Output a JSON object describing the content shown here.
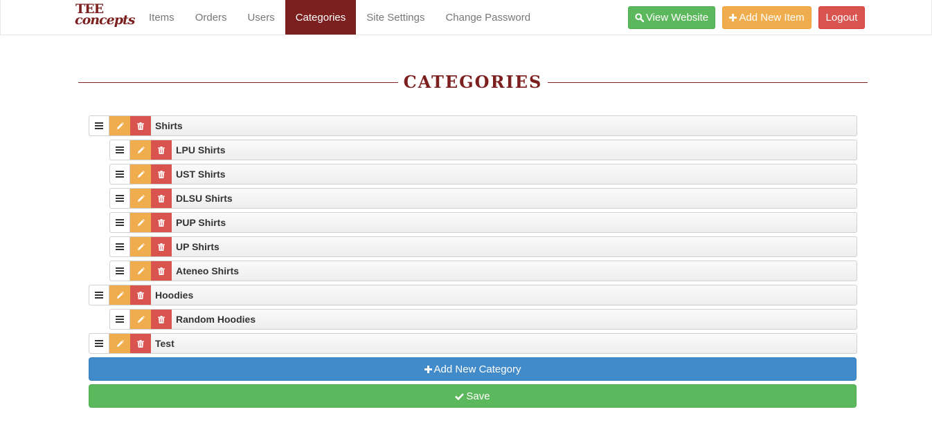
{
  "brand": {
    "line1": "TEE",
    "line2": "concepts"
  },
  "nav": {
    "items": [
      {
        "label": "Items",
        "active": false
      },
      {
        "label": "Orders",
        "active": false
      },
      {
        "label": "Users",
        "active": false
      },
      {
        "label": "Categories",
        "active": true
      },
      {
        "label": "Site Settings",
        "active": false
      },
      {
        "label": "Change Password",
        "active": false
      }
    ],
    "view_website": "View Website",
    "add_new_item": "Add New Item",
    "logout": "Logout"
  },
  "page": {
    "title": "CATEGORIES"
  },
  "categories": [
    {
      "label": "Shirts",
      "level": 0
    },
    {
      "label": "LPU Shirts",
      "level": 1
    },
    {
      "label": "UST Shirts",
      "level": 1
    },
    {
      "label": "DLSU Shirts",
      "level": 1
    },
    {
      "label": "PUP Shirts",
      "level": 1
    },
    {
      "label": "UP Shirts",
      "level": 1
    },
    {
      "label": "Ateneo Shirts",
      "level": 1
    },
    {
      "label": "Hoodies",
      "level": 0
    },
    {
      "label": "Random Hoodies",
      "level": 1
    },
    {
      "label": "Test",
      "level": 0
    }
  ],
  "actions": {
    "add_category": "Add New Category",
    "save": "Save"
  },
  "colors": {
    "brand": "#7b1f1f",
    "success": "#5cb85c",
    "warning": "#f0ad4e",
    "danger": "#d9534f",
    "primary": "#428bca"
  },
  "icons": {
    "view": "search-icon",
    "add": "plus-icon",
    "handle": "bars-icon",
    "edit": "pencil-icon",
    "delete": "trash-icon",
    "save": "check-icon"
  }
}
